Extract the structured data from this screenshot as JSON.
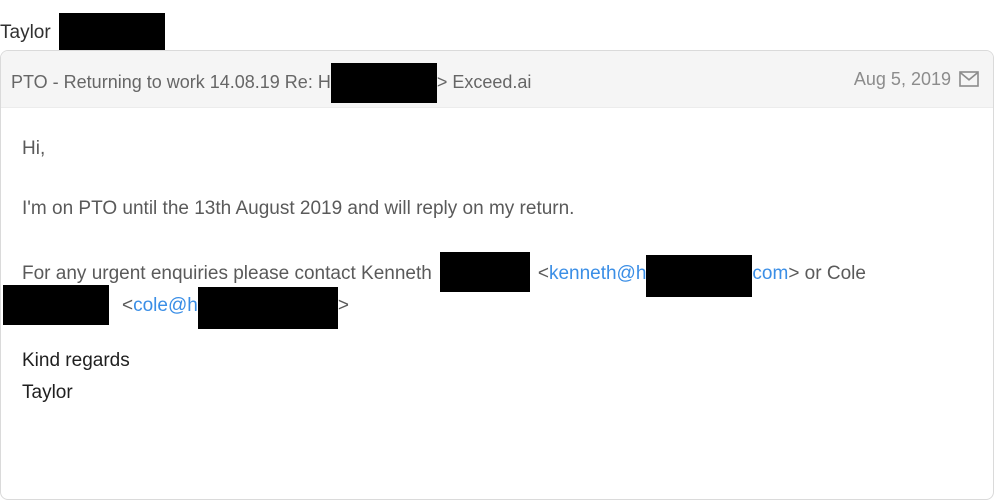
{
  "sender": {
    "name": "Taylor"
  },
  "header": {
    "subject_prefix": "PTO - Returning to work 14.08.19 Re: H",
    "subject_suffix": "> Exceed.ai",
    "date": "Aug 5, 2019",
    "icon": "envelope-icon"
  },
  "body": {
    "greeting": "Hi,",
    "pto_line": "I'm on PTO until the 13th August 2019 and will reply on my return.",
    "urgent_prefix": "For any urgent enquiries please contact Kenneth",
    "kenneth_email_open": "<",
    "kenneth_email_start": "kenneth@h",
    "kenneth_email_end": "com",
    "kenneth_email_close": "> or Cole",
    "cole_email_open": "<",
    "cole_email_start": "cole@h",
    "cole_email_close": ">",
    "signoff": "Kind regards",
    "signature": "Taylor"
  },
  "colors": {
    "link": "#3a8ee6",
    "redaction": "#000000",
    "header_bg": "#f5f5f5"
  }
}
